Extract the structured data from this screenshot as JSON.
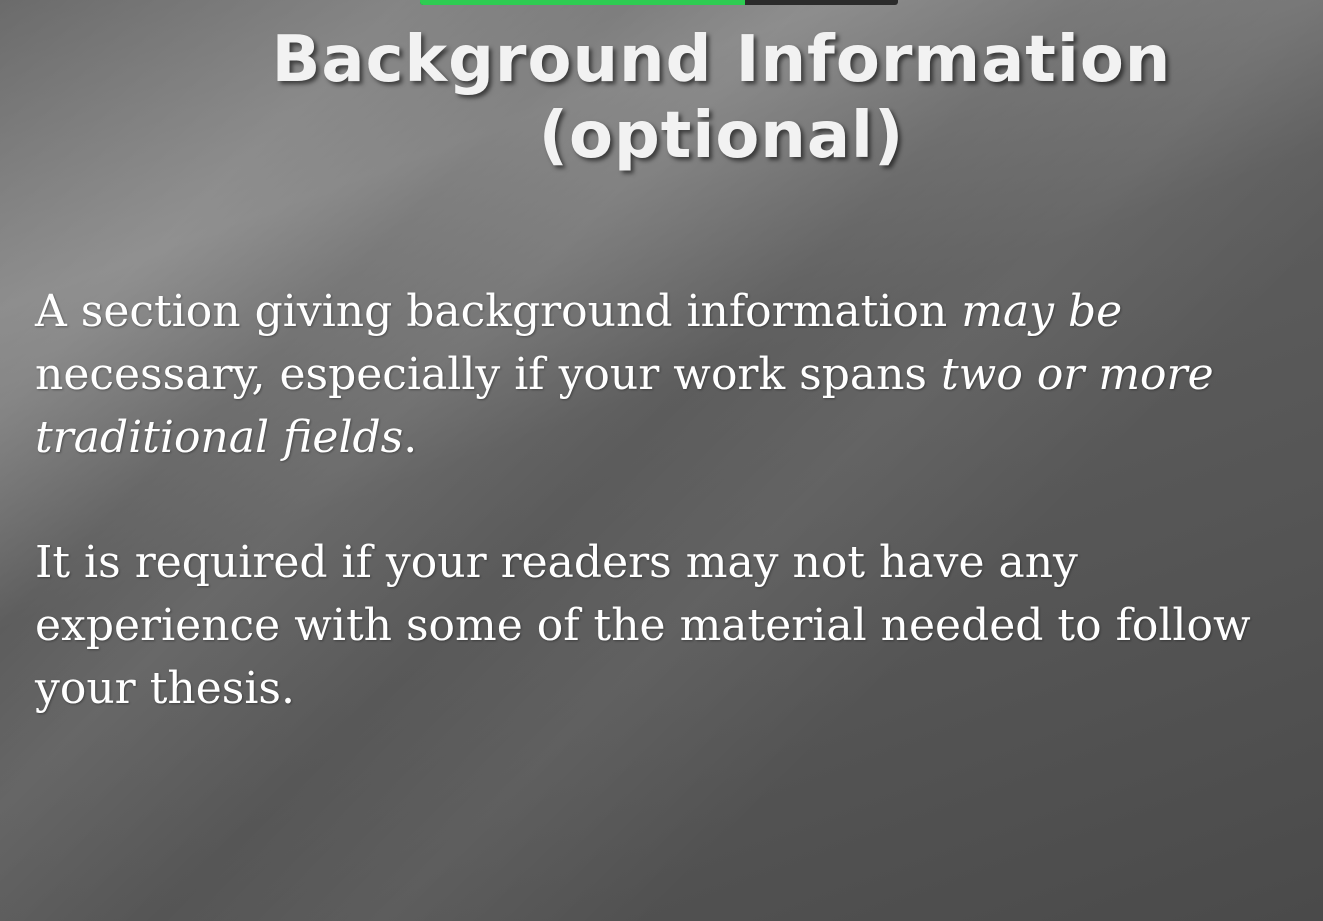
{
  "playback": {
    "progress_fraction": 0.68,
    "fill_color": "#2ecc52",
    "track_color": "#2b2b2b"
  },
  "slide": {
    "title_line1": "Background Information",
    "title_line2": "(optional)",
    "paragraph1": {
      "seg1": "A section giving background information ",
      "seg2_italic": "may be",
      "seg3": " necessary, especially if your work spans ",
      "seg4_italic": "two or more traditional fields",
      "seg5": "."
    },
    "paragraph2": "It is required if your readers may not have any experience with some of the material needed to follow your thesis."
  }
}
